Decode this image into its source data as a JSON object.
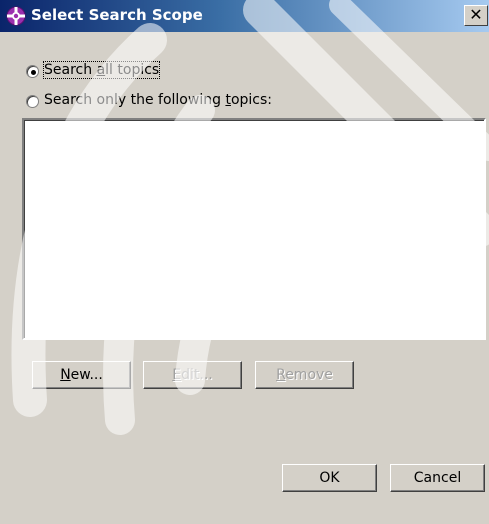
{
  "window": {
    "title": "Select Search Scope",
    "close_label": "✕"
  },
  "scope_options": {
    "all_topics": {
      "label_pre": "Search ",
      "label_accel": "a",
      "label_post": "ll topics",
      "selected": true
    },
    "selected_topics": {
      "label_pre": "Search only the following ",
      "label_accel": "t",
      "label_post": "opics:",
      "selected": false
    }
  },
  "topic_buttons": {
    "new": {
      "accel": "N",
      "rest": "ew...",
      "enabled": true
    },
    "edit": {
      "accel": "E",
      "rest": "dit...",
      "enabled": false
    },
    "remove": {
      "accel": "R",
      "rest": "emove",
      "enabled": false
    }
  },
  "dialog_buttons": {
    "ok": "OK",
    "cancel": "Cancel"
  },
  "colors": {
    "face": "#d4d0c8",
    "title_start": "#0a246a",
    "title_end": "#a6caf0",
    "icon_purple": "#9b2fae"
  },
  "icons": {
    "title": "help-scope-icon",
    "close": "close-icon"
  }
}
